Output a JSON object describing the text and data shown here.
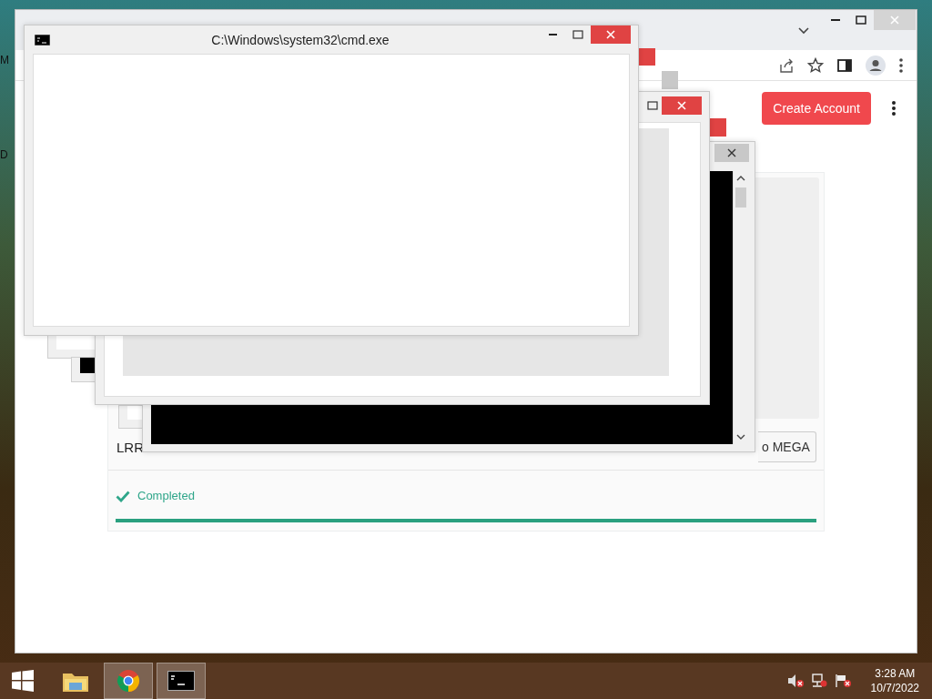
{
  "desktop": {
    "labels": [
      "M",
      "D"
    ]
  },
  "browser": {
    "create_account": "Create Account",
    "card": {
      "title": "LRR",
      "button": "o MEGA",
      "status": "Completed",
      "progress": {
        "level": 1
      }
    }
  },
  "cmd_windows": [
    {
      "kind": "console"
    },
    {
      "kind": "blank"
    },
    {
      "kind": "front",
      "title": "C:\\Windows\\system32\\cmd.exe"
    }
  ],
  "taskbar": {
    "apps": [
      {
        "kind": "explorer",
        "running": false
      },
      {
        "kind": "chrome",
        "running": true
      },
      {
        "kind": "cmd",
        "running": true
      }
    ],
    "clock": {
      "time": "3:28 AM",
      "date": "10/7/2022"
    }
  }
}
